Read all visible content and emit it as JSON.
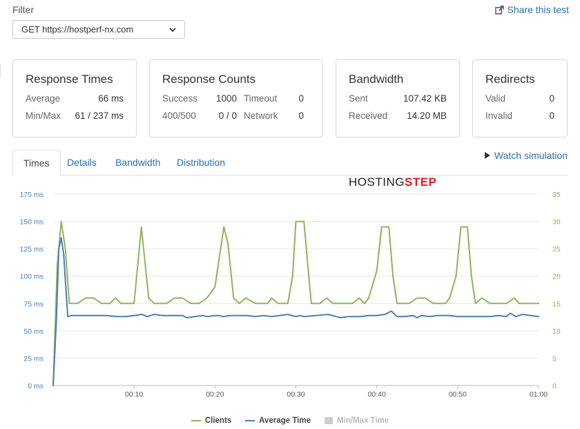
{
  "filter": {
    "label": "Filter",
    "selected": "GET https://hostperf-nx.com"
  },
  "share": {
    "label": "Share this test",
    "icon": "share-external-icon"
  },
  "cards": {
    "response_times": {
      "title": "Response Times",
      "average_label": "Average",
      "average_value": "66 ms",
      "minmax_label": "Min/Max",
      "minmax_value": "61 / 237 ms"
    },
    "response_counts": {
      "title": "Response Counts",
      "success_label": "Success",
      "success_value": "1000",
      "timeout_label": "Timeout",
      "timeout_value": "0",
      "err_label": "400/500",
      "err_value": "0 / 0",
      "network_label": "Network",
      "network_value": "0"
    },
    "bandwidth": {
      "title": "Bandwidth",
      "sent_label": "Sent",
      "sent_value": "107.42 KB",
      "received_label": "Received",
      "received_value": "14.20 MB"
    },
    "redirects": {
      "title": "Redirects",
      "valid_label": "Valid",
      "valid_value": "0",
      "invalid_label": "Invalid",
      "invalid_value": "0"
    }
  },
  "tabs": [
    {
      "label": "Times",
      "active": true
    },
    {
      "label": "Details",
      "active": false
    },
    {
      "label": "Bandwidth",
      "active": false
    },
    {
      "label": "Distribution",
      "active": false
    }
  ],
  "watch_simulation": {
    "label": "Watch simulation",
    "icon": "play-icon"
  },
  "brand": {
    "part1": "HOSTING",
    "part2": "STEP"
  },
  "colors": {
    "clients": "#8fb35a",
    "average": "#4a7eb0",
    "link": "#2a6fb0",
    "grid": "#e6e6e6",
    "left_axis": "#4a7eb0",
    "right_axis": "#8fb35a"
  },
  "chart_data": {
    "type": "line",
    "x_ticks": [
      "00:10",
      "00:20",
      "00:30",
      "00:40",
      "00:50",
      "01:00"
    ],
    "x_tick_seconds": [
      10,
      20,
      30,
      40,
      50,
      60
    ],
    "xlim": [
      0,
      60
    ],
    "y_left": {
      "ticks": [
        "0 ms",
        "25 ms",
        "50 ms",
        "75 ms",
        "100 ms",
        "125 ms",
        "150 ms",
        "175 ms"
      ],
      "lim": [
        0,
        175
      ]
    },
    "y_right": {
      "ticks": [
        "0",
        "5",
        "10",
        "15",
        "20",
        "25",
        "30",
        "35"
      ],
      "lim": [
        0,
        35
      ]
    },
    "grid": true,
    "legend_position": "bottom-center",
    "series": [
      {
        "name": "Clients",
        "axis": "right",
        "points": [
          [
            0,
            0
          ],
          [
            0.5,
            22
          ],
          [
            1,
            30
          ],
          [
            1.5,
            25
          ],
          [
            2,
            15
          ],
          [
            3,
            15
          ],
          [
            4,
            16
          ],
          [
            5,
            16
          ],
          [
            6,
            15
          ],
          [
            7,
            15
          ],
          [
            7.7,
            16
          ],
          [
            8.4,
            15
          ],
          [
            10,
            15
          ],
          [
            10.9,
            29
          ],
          [
            11.8,
            16
          ],
          [
            12.5,
            15
          ],
          [
            14,
            15
          ],
          [
            15,
            16
          ],
          [
            16,
            16
          ],
          [
            17,
            15
          ],
          [
            18,
            15
          ],
          [
            19,
            16
          ],
          [
            20,
            18
          ],
          [
            20.7,
            25
          ],
          [
            21.1,
            29
          ],
          [
            21.6,
            26
          ],
          [
            22.3,
            16
          ],
          [
            23,
            15
          ],
          [
            23.8,
            16
          ],
          [
            25,
            15
          ],
          [
            26.5,
            15
          ],
          [
            27,
            16
          ],
          [
            27.8,
            15
          ],
          [
            29,
            15
          ],
          [
            29.6,
            20
          ],
          [
            30,
            30
          ],
          [
            31,
            30
          ],
          [
            31.3,
            25
          ],
          [
            31.9,
            15
          ],
          [
            33,
            15
          ],
          [
            33.8,
            16
          ],
          [
            34.6,
            15
          ],
          [
            36,
            15
          ],
          [
            37,
            15
          ],
          [
            37.8,
            16
          ],
          [
            38.5,
            15
          ],
          [
            39,
            16
          ],
          [
            40,
            21
          ],
          [
            40.6,
            29
          ],
          [
            41.5,
            29
          ],
          [
            42,
            20
          ],
          [
            42.5,
            15
          ],
          [
            44,
            15
          ],
          [
            45,
            16
          ],
          [
            46,
            16
          ],
          [
            47,
            15
          ],
          [
            48.5,
            15
          ],
          [
            49,
            16
          ],
          [
            49.8,
            20
          ],
          [
            50.4,
            29
          ],
          [
            51.2,
            29
          ],
          [
            51.7,
            20
          ],
          [
            52.2,
            15
          ],
          [
            53,
            16
          ],
          [
            54,
            15
          ],
          [
            55,
            15
          ],
          [
            56,
            15
          ],
          [
            57,
            16
          ],
          [
            57.6,
            15
          ],
          [
            58.5,
            15
          ],
          [
            59.5,
            15
          ],
          [
            60,
            15
          ]
        ]
      },
      {
        "name": "Average Time",
        "axis": "left",
        "points": [
          [
            0,
            0
          ],
          [
            0.4,
            60
          ],
          [
            0.7,
            125
          ],
          [
            1,
            135
          ],
          [
            1.3,
            120
          ],
          [
            1.8,
            63
          ],
          [
            2.3,
            64
          ],
          [
            3,
            64
          ],
          [
            5,
            64
          ],
          [
            6.5,
            64
          ],
          [
            8,
            63
          ],
          [
            9,
            63
          ],
          [
            10,
            64
          ],
          [
            11,
            65
          ],
          [
            11.6,
            63
          ],
          [
            12.5,
            65
          ],
          [
            13.5,
            64
          ],
          [
            15,
            64
          ],
          [
            16,
            64
          ],
          [
            16.5,
            62
          ],
          [
            17.5,
            63
          ],
          [
            18.5,
            64
          ],
          [
            19,
            63
          ],
          [
            20,
            64
          ],
          [
            20.5,
            64
          ],
          [
            21,
            63
          ],
          [
            22,
            64
          ],
          [
            24,
            64
          ],
          [
            25,
            63
          ],
          [
            26,
            64
          ],
          [
            27,
            63
          ],
          [
            28,
            64
          ],
          [
            29,
            65
          ],
          [
            30,
            63
          ],
          [
            30.5,
            64
          ],
          [
            31,
            63
          ],
          [
            32.5,
            64
          ],
          [
            34,
            65
          ],
          [
            35,
            63
          ],
          [
            35.5,
            62
          ],
          [
            36.5,
            63
          ],
          [
            38,
            63
          ],
          [
            39,
            64
          ],
          [
            40,
            64
          ],
          [
            41,
            65
          ],
          [
            41.8,
            68
          ],
          [
            42.5,
            63
          ],
          [
            43.5,
            63
          ],
          [
            44.5,
            64
          ],
          [
            45,
            62
          ],
          [
            45.5,
            64
          ],
          [
            46.5,
            63
          ],
          [
            47.5,
            64
          ],
          [
            49,
            64
          ],
          [
            50,
            63
          ],
          [
            51,
            63
          ],
          [
            52,
            63
          ],
          [
            54,
            63
          ],
          [
            55,
            64
          ],
          [
            56,
            63
          ],
          [
            56.5,
            66
          ],
          [
            57.2,
            63
          ],
          [
            58,
            65
          ],
          [
            59,
            64
          ],
          [
            60,
            63
          ]
        ]
      }
    ],
    "legend": [
      {
        "label": "Clients",
        "enabled": true
      },
      {
        "label": "Average Time",
        "enabled": true
      },
      {
        "label": "Min/Max Time",
        "enabled": false
      }
    ]
  }
}
